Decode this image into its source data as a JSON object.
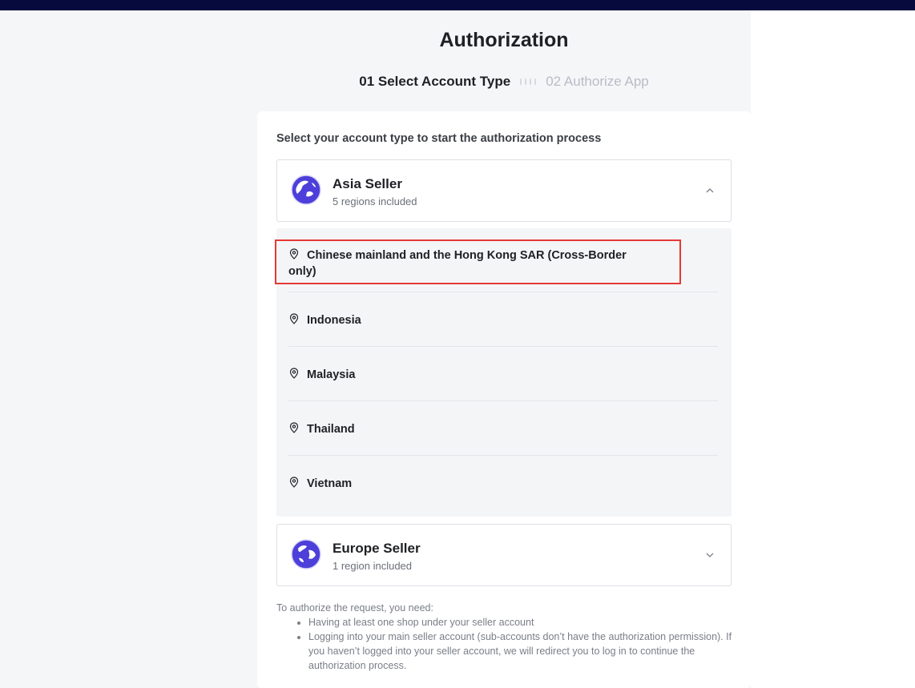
{
  "header": {
    "title": "Authorization"
  },
  "steps": {
    "step1": "01 Select Account Type",
    "step2": "02 Authorize App"
  },
  "card": {
    "instruction": "Select your account type to start the authorization process"
  },
  "sellers": {
    "asia": {
      "name": "Asia Seller",
      "subtitle": "5 regions included",
      "icon": "globe-icon",
      "expanded": true
    },
    "europe": {
      "name": "Europe Seller",
      "subtitle": "1 region included",
      "icon": "globe-icon",
      "expanded": false
    }
  },
  "regions": [
    "Chinese mainland and the Hong Kong SAR (Cross-Border only)",
    "Indonesia",
    "Malaysia",
    "Thailand",
    "Vietnam"
  ],
  "requirements": {
    "intro": "To authorize the request, you need:",
    "items": [
      "Having at least one shop under your seller account",
      "Logging into your main seller account (sub-accounts don’t have the authorization permission). If you haven’t logged into your seller account, we will redirect you to log in to continue the authorization process."
    ]
  },
  "colors": {
    "topbar": "#060a3c",
    "globe": "#4d3fd9",
    "highlight": "#e53935"
  }
}
